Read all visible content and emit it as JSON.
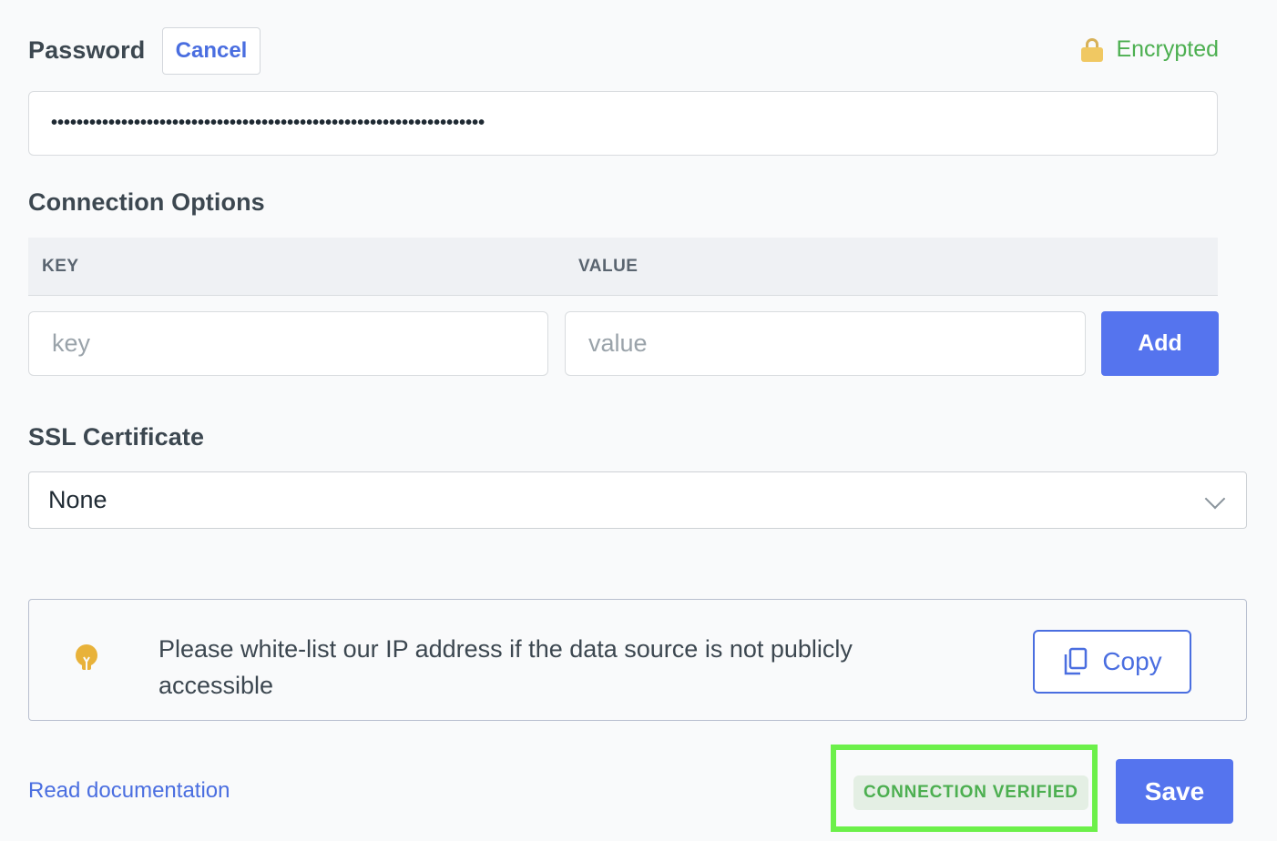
{
  "password": {
    "label": "Password",
    "cancel_label": "Cancel",
    "encrypted_label": "Encrypted",
    "value_masked": "••••••••••••••••••••••••••••••••••••••••••••••••••••••••••••••••••••"
  },
  "connection_options": {
    "title": "Connection Options",
    "columns": [
      "KEY",
      "VALUE"
    ],
    "key_placeholder": "key",
    "value_placeholder": "value",
    "add_label": "Add"
  },
  "ssl": {
    "label": "SSL Certificate",
    "selected": "None"
  },
  "info": {
    "message": "Please white-list our IP address if the data source is not publicly accessible",
    "copy_label": "Copy"
  },
  "footer": {
    "doc_link": "Read documentation",
    "status_badge": "CONNECTION VERIFIED",
    "save_label": "Save"
  },
  "colors": {
    "accent": "#5574ee",
    "link": "#4a6ee0",
    "success": "#4caf50",
    "highlight_frame": "#6cf04a",
    "bulb": "#e8b23a"
  },
  "icons": [
    "lock-icon",
    "chevron-down-icon",
    "lightbulb-icon",
    "copy-icon"
  ]
}
